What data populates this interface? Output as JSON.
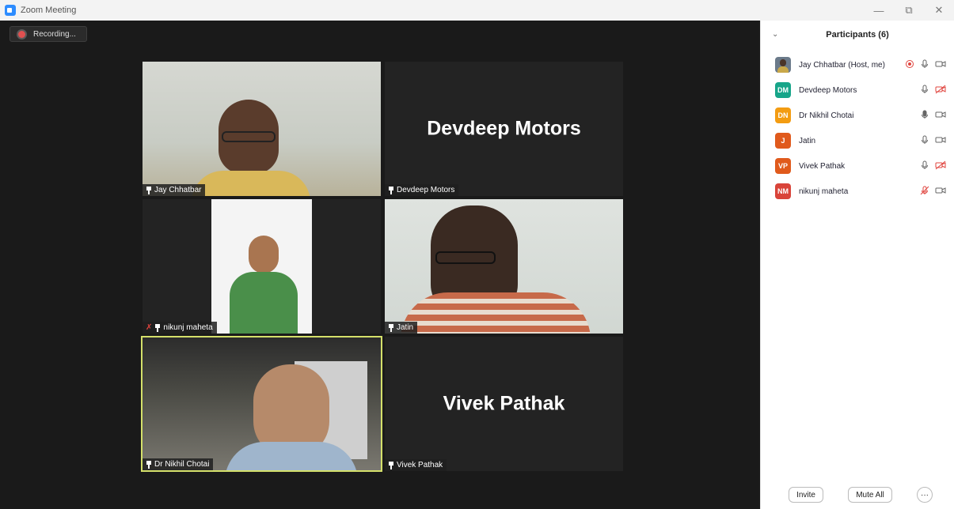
{
  "window": {
    "title": "Zoom Meeting",
    "minimize": "—",
    "restore": "⧉",
    "close": "✕"
  },
  "recording": {
    "label": "Recording..."
  },
  "tiles": {
    "jay": {
      "name": "Jay Chhatbar"
    },
    "devdeep": {
      "name": "Devdeep Motors",
      "big_name": "Devdeep Motors"
    },
    "nikunj": {
      "name": "nikunj maheta"
    },
    "jatin": {
      "name": "Jatin"
    },
    "nikhil": {
      "name": "Dr Nikhil Chotai"
    },
    "vivek": {
      "name": "Vivek Pathak",
      "big_name": "Vivek Pathak"
    }
  },
  "participants": {
    "title": "Participants (6)",
    "list": [
      {
        "initials": "",
        "name": "Jay Chhatbar (Host, me)",
        "color": "#6b7a8a"
      },
      {
        "initials": "DM",
        "name": "Devdeep Motors",
        "color": "#17a589"
      },
      {
        "initials": "DN",
        "name": "Dr Nikhil Chotai",
        "color": "#f39c12"
      },
      {
        "initials": "J",
        "name": "Jatin",
        "color": "#e05a1c"
      },
      {
        "initials": "VP",
        "name": "Vivek Pathak",
        "color": "#e05a1c"
      },
      {
        "initials": "NM",
        "name": "nikunj maheta",
        "color": "#d9443a"
      }
    ],
    "invite_label": "Invite",
    "mute_all_label": "Mute All",
    "more_label": "···"
  },
  "colors": {
    "speaker_highlight": "#d4e06a",
    "muted_red": "#e0443e"
  }
}
